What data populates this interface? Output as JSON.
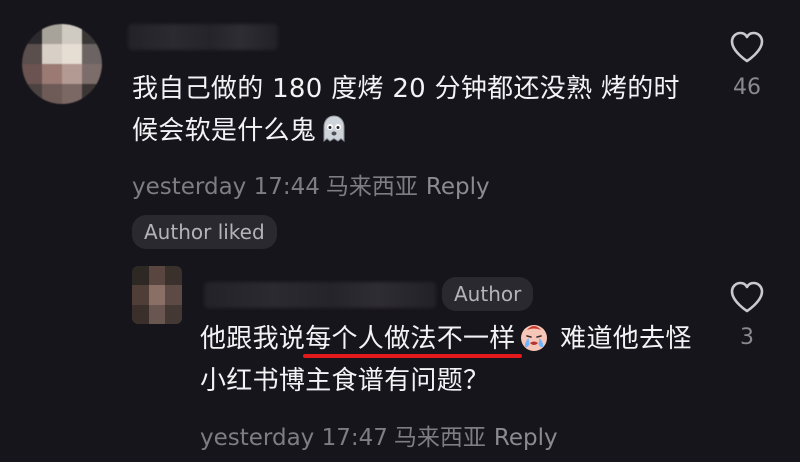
{
  "comment": {
    "text_before_emoji": "我自己做的 180 度烤 20 分钟都还没熟 烤的时候会软是什么鬼",
    "emoji": "ghost-face-emoji",
    "timestamp": "yesterday 17:44",
    "location": "马来西亚",
    "reply_label": "Reply",
    "badge": "Author liked",
    "like_count": "46"
  },
  "reply": {
    "text_prefix": "他跟我说",
    "text_highlight": "每个人做法不一样",
    "emoji": "crying-face-emoji",
    "text_suffix": " 难道他去怪小红书博主食谱有问题？",
    "author_tag": "Author",
    "timestamp": "yesterday 17:47",
    "location": "马来西亚",
    "reply_label": "Reply",
    "like_count": "3"
  },
  "colors": {
    "background": "#16151b",
    "underline": "#e3191b",
    "meta_text": "#7e7d84"
  }
}
